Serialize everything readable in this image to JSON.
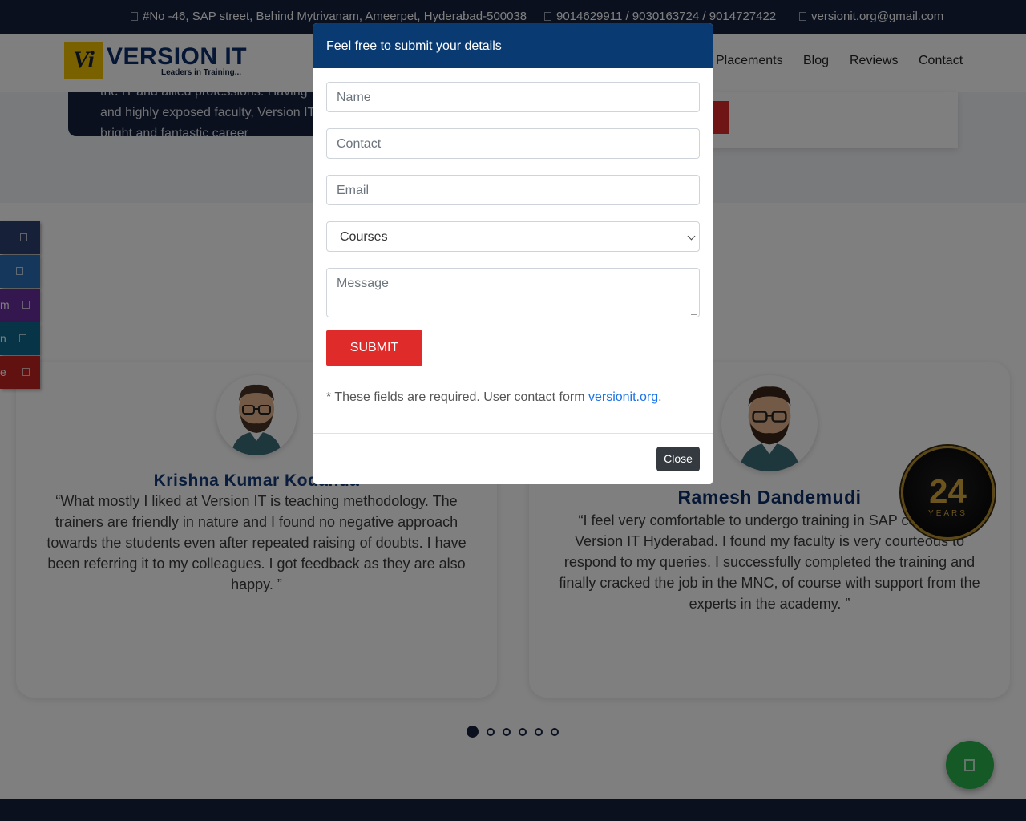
{
  "topbar": {
    "address": "#No -46, SAP street, Behind Mytrivanam, Ameerpet, Hyderabad-500038",
    "phones": "9014629911 / 9030163724 / 9014727422",
    "email": "versionit.org@gmail.com"
  },
  "header": {
    "logo_mark": "Vi",
    "logo_name": "VERSION IT",
    "logo_tagline": "Leaders in Training...",
    "nav": [
      "Placements",
      "Blog",
      "Reviews",
      "Contact"
    ]
  },
  "about": {
    "lines": [
      "the IT and allied professions. Having",
      "and highly exposed faculty, Version IT",
      "bright and fantastic career"
    ]
  },
  "social": [
    "",
    "",
    "m",
    "n",
    "e"
  ],
  "testimonials": [
    {
      "name": "Krishna Kumar Kodanda",
      "quote": "“What mostly I liked at Version IT is teaching methodology. The trainers are friendly in nature and I found no negative approach towards the students even after repeated raising of doubts. I have been referring it to my colleagues. I got feedback as they are also happy. ”"
    },
    {
      "name": "Ramesh Dandemudi",
      "quote": "“I feel very comfortable to undergo training in SAP course at Version IT Hyderabad. I found my faculty is very courteous to respond to my queries. I successfully completed the training and finally cracked the job in the MNC, of course with support from the experts in the academy. ”"
    }
  ],
  "carousel": {
    "total": 6,
    "active": 1
  },
  "badge": {
    "number": "24",
    "label": "YEARS"
  },
  "modal": {
    "title": "Feel free to submit your details",
    "name_placeholder": "Name",
    "contact_placeholder": "Contact",
    "email_placeholder": "Email",
    "courses_selected": "Courses",
    "message_placeholder": "Message",
    "submit_label": "SUBMIT",
    "note_text": "* These fields are required. User contact form ",
    "note_link": "versionit.org",
    "note_end": ".",
    "close_label": "Close"
  },
  "colors": {
    "navy": "#14213d",
    "header_blue": "#0a3a72",
    "accent_red": "#e02b2b",
    "whatsapp_green": "#2bb24c",
    "social": [
      "#2d4373",
      "#2a6fb8",
      "#6a2e9e",
      "#0f6b8f",
      "#c42323"
    ]
  },
  "icons": {
    "address": "map-marker-icon",
    "phone": "phone-icon",
    "email": "envelope-icon",
    "whatsapp": "whatsapp-icon",
    "social": [
      "facebook-icon",
      "twitter-icon",
      "instagram-icon",
      "linkedin-icon",
      "youtube-icon"
    ]
  }
}
